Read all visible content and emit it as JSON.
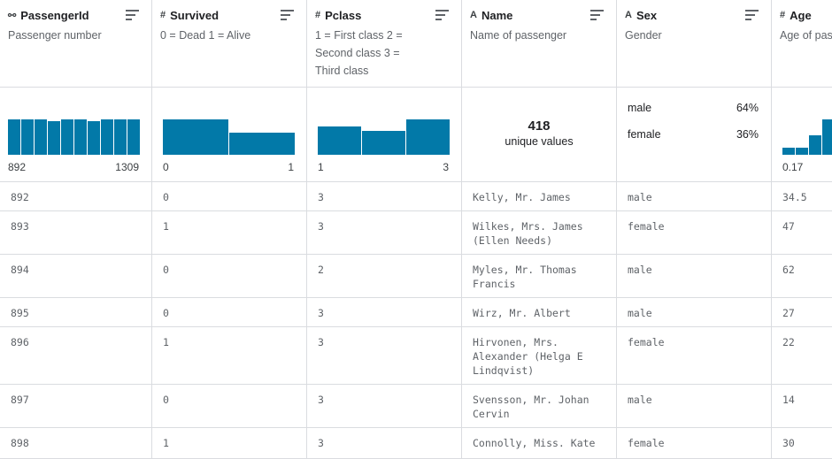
{
  "columns": [
    {
      "type_icon": "key-icon",
      "type_glyph": "⚯",
      "title": "PassengerId",
      "description": "Passenger number"
    },
    {
      "type_icon": "number-icon",
      "type_glyph": "#",
      "title": "Survived",
      "description": "0 = Dead 1 = Alive"
    },
    {
      "type_icon": "number-icon",
      "type_glyph": "#",
      "title": "Pclass",
      "description": "1 = First class 2 = Second class 3 = Third class"
    },
    {
      "type_icon": "text-icon",
      "type_glyph": "A",
      "title": "Name",
      "description": "Name of passenger"
    },
    {
      "type_icon": "text-icon",
      "type_glyph": "A",
      "title": "Sex",
      "description": "Gender"
    },
    {
      "type_icon": "number-icon",
      "type_glyph": "#",
      "title": "Age",
      "description": "Age of passenger"
    }
  ],
  "summaries": {
    "passengerid": {
      "histogram": [
        1,
        1,
        1,
        0.95,
        1,
        1,
        0.95,
        1,
        1,
        1
      ],
      "min": "892",
      "max": "1309"
    },
    "survived": {
      "histogram": [
        1,
        0.63
      ],
      "min": "0",
      "max": "1"
    },
    "pclass": {
      "histogram": [
        0.8,
        0.68,
        1
      ],
      "min": "1",
      "max": "3"
    },
    "name": {
      "unique_count": "418",
      "unique_label": "unique values"
    },
    "sex": {
      "categories": [
        {
          "label": "male",
          "pct": "64%"
        },
        {
          "label": "female",
          "pct": "36%"
        }
      ]
    },
    "age": {
      "histogram": [
        0.2,
        0.2,
        0.55,
        1
      ],
      "min": "0.17"
    }
  },
  "rows": [
    {
      "passengerid": "892",
      "survived": "0",
      "pclass": "3",
      "name": "Kelly, Mr. James",
      "sex": "male",
      "age": "34.5"
    },
    {
      "passengerid": "893",
      "survived": "1",
      "pclass": "3",
      "name": "Wilkes, Mrs. James (Ellen Needs)",
      "sex": "female",
      "age": "47"
    },
    {
      "passengerid": "894",
      "survived": "0",
      "pclass": "2",
      "name": "Myles, Mr. Thomas Francis",
      "sex": "male",
      "age": "62"
    },
    {
      "passengerid": "895",
      "survived": "0",
      "pclass": "3",
      "name": "Wirz, Mr. Albert",
      "sex": "male",
      "age": "27"
    },
    {
      "passengerid": "896",
      "survived": "1",
      "pclass": "3",
      "name": "Hirvonen, Mrs. Alexander (Helga E Lindqvist)",
      "sex": "female",
      "age": "22"
    },
    {
      "passengerid": "897",
      "survived": "0",
      "pclass": "3",
      "name": "Svensson, Mr. Johan Cervin",
      "sex": "male",
      "age": "14"
    },
    {
      "passengerid": "898",
      "survived": "1",
      "pclass": "3",
      "name": "Connolly, Miss. Kate",
      "sex": "female",
      "age": "30"
    }
  ],
  "colors": {
    "bar": "#0279a8",
    "grid": "#dadce0"
  }
}
